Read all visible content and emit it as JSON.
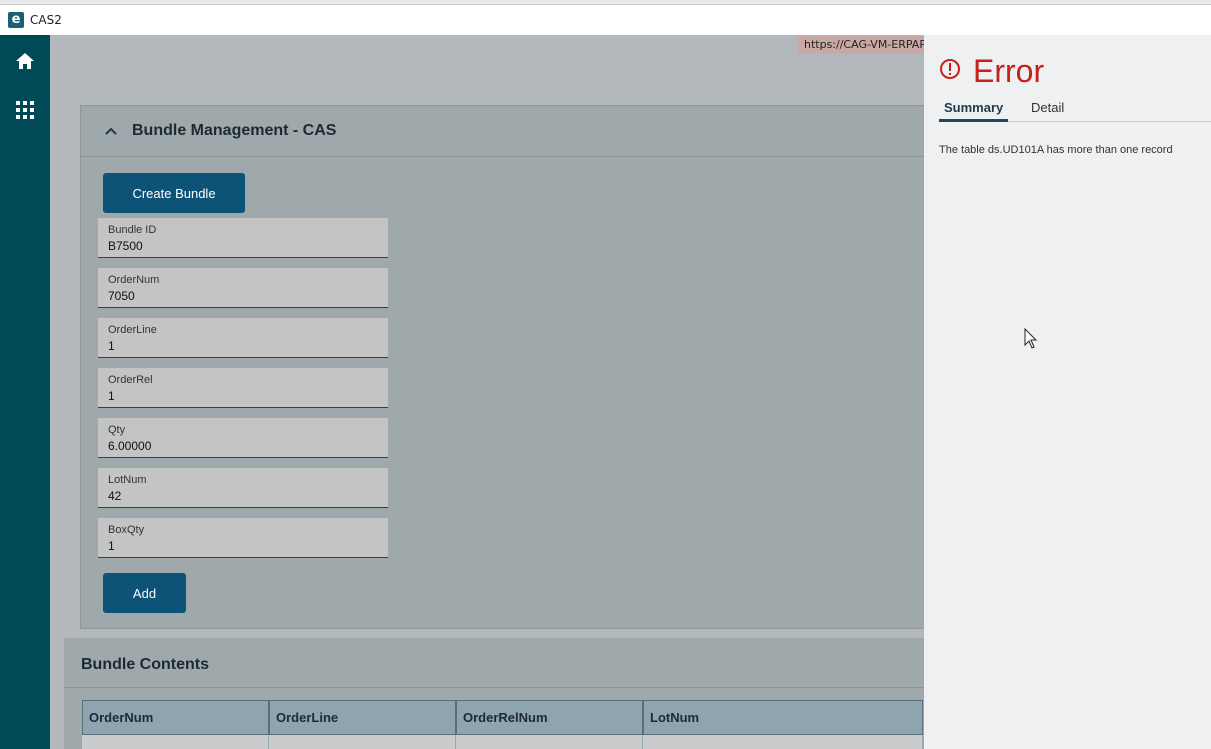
{
  "window": {
    "title": "CAS2",
    "logo_letter": "e"
  },
  "nav": {
    "items": [
      {
        "icon": "home-icon"
      },
      {
        "icon": "apps-grid-icon"
      }
    ]
  },
  "tooltip": {
    "url": "https://CAG-VM-ERPAPP"
  },
  "panel": {
    "title": "Bundle Management - CAS",
    "create_button": "Create Bundle",
    "add_button": "Add",
    "fields": [
      {
        "label": "Bundle ID",
        "value": "B7500"
      },
      {
        "label": "OrderNum",
        "value": "7050"
      },
      {
        "label": "OrderLine",
        "value": "1"
      },
      {
        "label": "OrderRel",
        "value": "1"
      },
      {
        "label": "Qty",
        "value": "6.00000"
      },
      {
        "label": "LotNum",
        "value": "42"
      },
      {
        "label": "BoxQty",
        "value": "1"
      }
    ]
  },
  "contents": {
    "title": "Bundle Contents",
    "columns": [
      "OrderNum",
      "OrderLine",
      "OrderRelNum",
      "LotNum"
    ]
  },
  "error": {
    "title": "Error",
    "tabs": [
      "Summary",
      "Detail"
    ],
    "active_tab": "Summary",
    "message": "The table ds.UD101A has more than one record",
    "color": "#c8201d"
  }
}
